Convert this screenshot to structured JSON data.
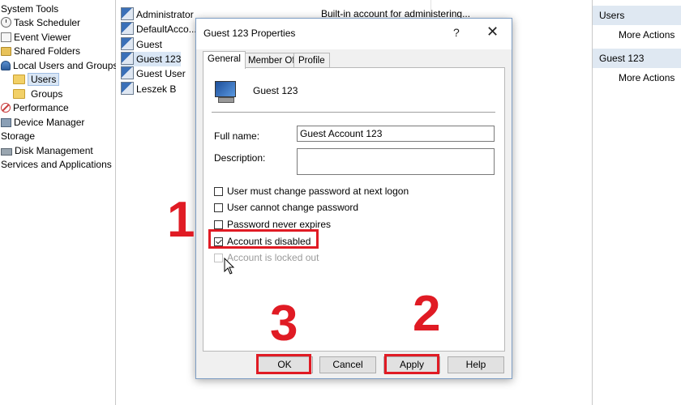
{
  "tree": {
    "items": [
      {
        "label": "System Tools",
        "icon": "none"
      },
      {
        "label": "Task Scheduler",
        "icon": "clock-icon"
      },
      {
        "label": "Event Viewer",
        "icon": "event-viewer-icon"
      },
      {
        "label": "Shared Folders",
        "icon": "shared-folder-icon"
      },
      {
        "label": "Local Users and Groups",
        "icon": "users-icon"
      },
      {
        "label": "Users",
        "icon": "folder-icon"
      },
      {
        "label": "Groups",
        "icon": "folder-icon"
      },
      {
        "label": "Performance",
        "icon": "performance-icon"
      },
      {
        "label": "Device Manager",
        "icon": "device-manager-icon"
      },
      {
        "label": "Storage",
        "icon": "none"
      },
      {
        "label": "Disk Management",
        "icon": "disk-icon"
      },
      {
        "label": "Services and Applications",
        "icon": "none"
      }
    ]
  },
  "list": {
    "rows": [
      "Administrator",
      "DefaultAcco...",
      "Guest",
      "Guest 123",
      "Guest User",
      "Leszek B"
    ],
    "first_description": "Built-in account for administering..."
  },
  "actions": {
    "header1": "Users",
    "more1": "More Actions",
    "header2": "Guest 123",
    "more2": "More Actions"
  },
  "dialog": {
    "title": "Guest 123 Properties",
    "help": "?",
    "close": "✕",
    "tabs": [
      "General",
      "Member Of",
      "Profile"
    ],
    "user_name": "Guest 123",
    "full_name_label": "Full name:",
    "full_name_value": "Guest Account 123",
    "description_label": "Description:",
    "description_value": "",
    "checkboxes": [
      {
        "label": "User must change password at next logon",
        "checked": false,
        "disabled": false
      },
      {
        "label": "User cannot change password",
        "checked": false,
        "disabled": false
      },
      {
        "label": "Password never expires",
        "checked": false,
        "disabled": false
      },
      {
        "label": "Account is disabled",
        "checked": true,
        "disabled": false
      },
      {
        "label": "Account is locked out",
        "checked": false,
        "disabled": true
      }
    ],
    "buttons": {
      "ok": "OK",
      "cancel": "Cancel",
      "apply": "Apply",
      "help": "Help"
    }
  },
  "annotations": {
    "step1": "1",
    "step2": "2",
    "step3": "3",
    "highlight_color": "#e01b24"
  }
}
